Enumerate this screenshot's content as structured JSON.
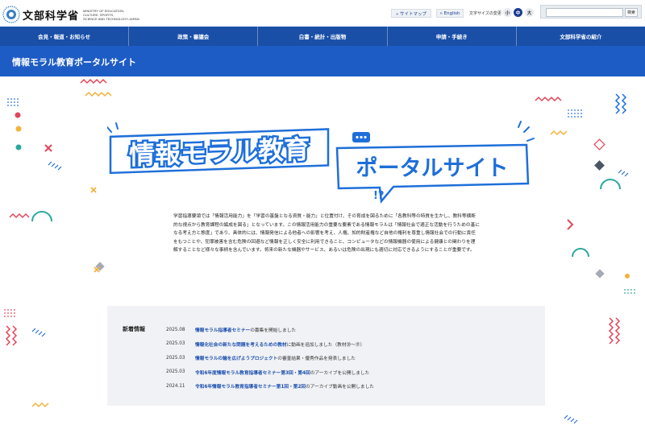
{
  "header": {
    "logo_text": "文部科学省",
    "logo_en_lines": [
      "MINISTRY OF EDUCATION,",
      "CULTURE, SPORTS,",
      "SCIENCE AND TECHNOLOGY-JAPAN"
    ],
    "sitemap_label": "» サイトマップ",
    "english_label": "» English",
    "fontsize_label": "文字サイズの変更",
    "fontsize_small": "小",
    "fontsize_mid": "中",
    "fontsize_large": "大",
    "search_value": "",
    "search_button": "検索"
  },
  "nav": [
    {
      "label": "会見・報道・お知らせ"
    },
    {
      "label": "政策・審議会"
    },
    {
      "label": "白書・統計・出版物"
    },
    {
      "label": "申請・手続き"
    },
    {
      "label": "文部科学省の紹介"
    }
  ],
  "page_title": "情報モラル教育ポータルサイト",
  "hero": {
    "title_left": "情報モラル教育",
    "title_right": "ポータルサイト",
    "bubble_mark": "!?"
  },
  "intro": "学習指導要領では「情報活用能力」を「学習の基盤となる資質・能力」と位置付け、その育成を図るために「各教科等の特質を生かし、教科等横断的な視点から教育課程の編成を図る」となっています。この情報活用能力の重要な要素である情報モラルは「情報社会で適正な活動を行うための基になる考え方と態度」であり、具体的には、情報発信による他者への影響を考え、人権、知的財産権など自他の権利を尊重し情報社会での行動に責任をもつことや、犯罪被害を含む危険の回避など情報を正しく安全に利用できること、コンピュータなどの情報機器の使用による健康との関わりを理解することなど様々な事柄を含んでいます。将来の新たな機器やサービス、あるいは危険の出現にも適切に対応できるようにすることが重要です。",
  "news": {
    "heading": "新着情報",
    "items": [
      {
        "date": "2025.08",
        "link": "情報モラル指導者セミナー",
        "rest": "の募集を開始しました"
      },
      {
        "date": "2025.03",
        "link": "情報化社会の新たな問題を考えるための教材",
        "rest": "に動画を追加しました（教材⑳〜㉛）"
      },
      {
        "date": "2025.03",
        "link": "情報モラルの輪を広げようプロジェクト",
        "rest": "の審査結果・優秀作品を発表しました"
      },
      {
        "date": "2025.03",
        "link": "令和6年度情報モラル教育指導者セミナー第3回・第4回",
        "rest": "のアーカイブを公開しました"
      },
      {
        "date": "2024.11",
        "link": "令和6年情報モラル教育指導者セミナー第1回・第2回",
        "rest": "のアーカイブ動画を公開しました"
      }
    ]
  },
  "colors": {
    "nav_bg": "#1a4fa8",
    "title_band": "#1e5cc5",
    "accent_blue": "#1e6fd9",
    "accent_red": "#e0475b",
    "accent_teal": "#2ba8a0",
    "accent_yellow": "#f3b23a"
  }
}
